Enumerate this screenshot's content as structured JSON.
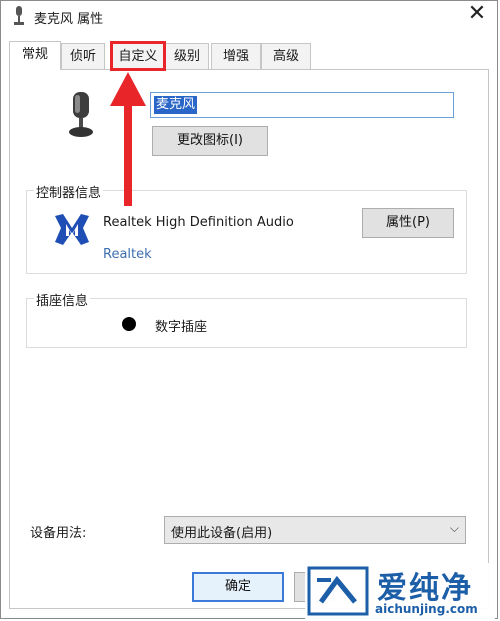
{
  "window": {
    "title": "麦克风 属性",
    "close_glyph": "✕"
  },
  "tabs": [
    {
      "label": "常规",
      "active": true
    },
    {
      "label": "侦听",
      "active": false
    },
    {
      "label": "自定义",
      "active": false,
      "highlighted": true
    },
    {
      "label": "级别",
      "active": false
    },
    {
      "label": "增强",
      "active": false
    },
    {
      "label": "高级",
      "active": false
    }
  ],
  "device": {
    "icon": "microphone-icon",
    "name_value": "麦克风",
    "change_icon_label": "更改图标(I)"
  },
  "controller": {
    "legend": "控制器信息",
    "logo": "realtek-logo-icon",
    "name": "Realtek High Definition Audio",
    "vendor_link": "Realtek",
    "properties_label": "属性(P)"
  },
  "jack": {
    "legend": "插座信息",
    "bullet_color": "#000000",
    "label": "数字插座"
  },
  "usage": {
    "label": "设备用法:",
    "selected": "使用此设备(启用)"
  },
  "footer": {
    "ok_label": "确定"
  },
  "watermark": {
    "brand": "爱纯净",
    "url": "aichunjing.com"
  },
  "colors": {
    "annotation_red": "#e8262a",
    "selection_blue": "#2a66c8",
    "link_blue": "#3d6fae",
    "watermark_blue": "#1c5fa8"
  }
}
